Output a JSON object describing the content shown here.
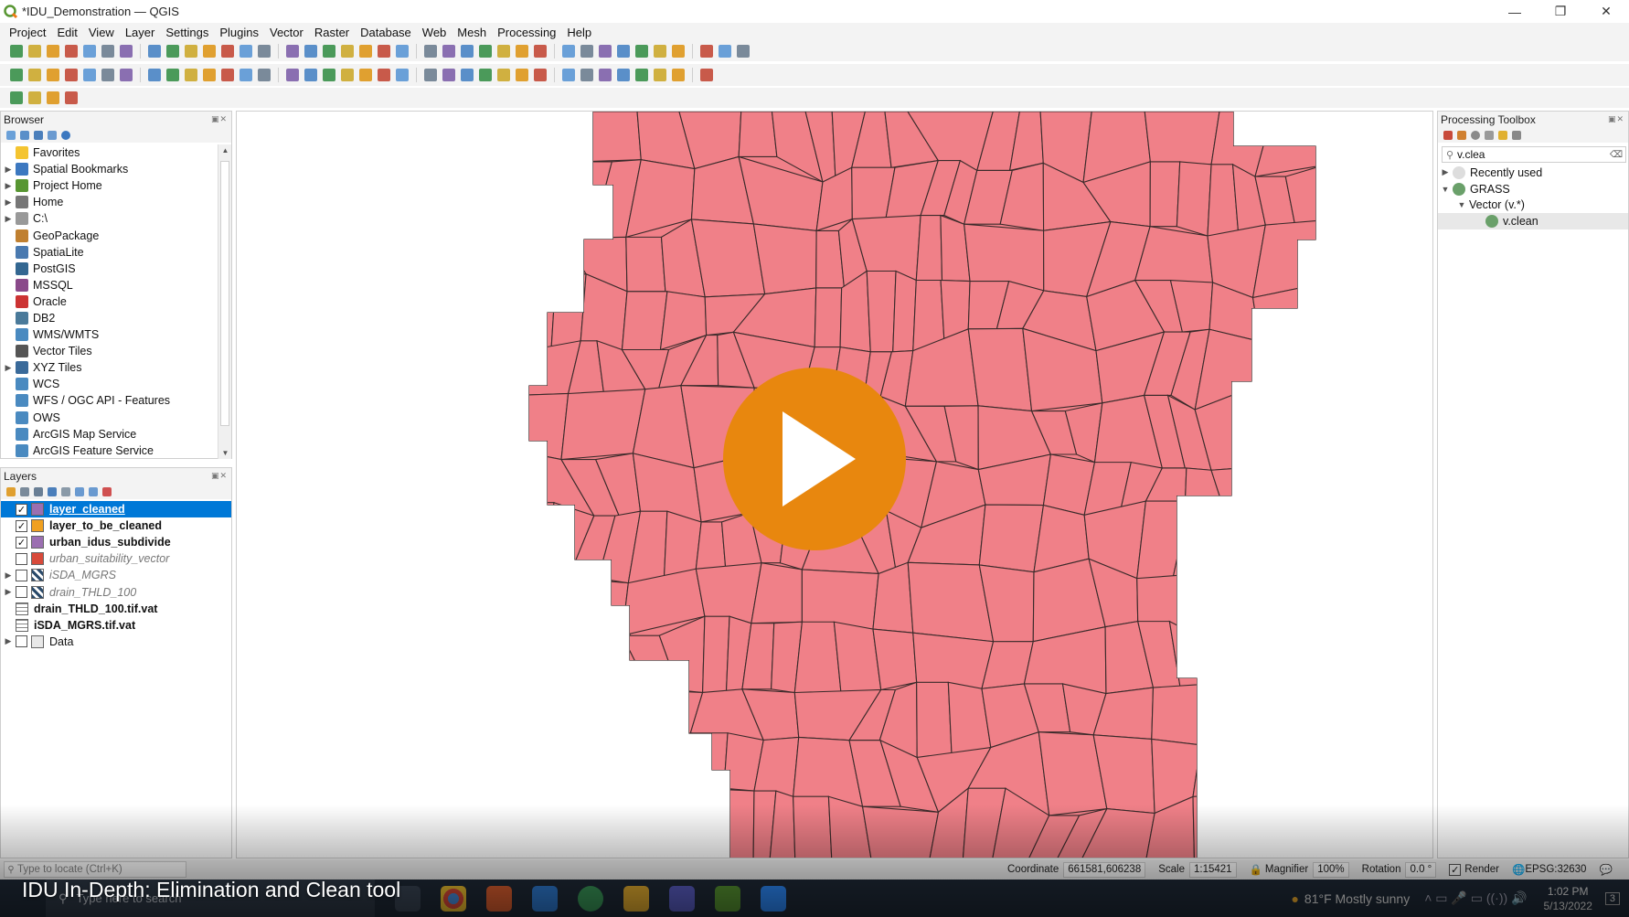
{
  "window": {
    "title": "*IDU_Demonstration — QGIS",
    "controls": [
      "—",
      "❐",
      "✕"
    ]
  },
  "menubar": [
    "Project",
    "Edit",
    "View",
    "Layer",
    "Settings",
    "Plugins",
    "Vector",
    "Raster",
    "Database",
    "Web",
    "Mesh",
    "Processing",
    "Help"
  ],
  "browser": {
    "title": "Browser",
    "items": [
      {
        "label": "Favorites",
        "icon": "star-icon",
        "expandable": false
      },
      {
        "label": "Spatial Bookmarks",
        "icon": "bookmark-icon",
        "expandable": true
      },
      {
        "label": "Project Home",
        "icon": "project-home-icon",
        "expandable": true
      },
      {
        "label": "Home",
        "icon": "home-icon",
        "expandable": true
      },
      {
        "label": "C:\\",
        "icon": "drive-icon",
        "expandable": true
      },
      {
        "label": "GeoPackage",
        "icon": "geopackage-icon",
        "expandable": false
      },
      {
        "label": "SpatiaLite",
        "icon": "spatialite-icon",
        "expandable": false
      },
      {
        "label": "PostGIS",
        "icon": "postgis-icon",
        "expandable": false
      },
      {
        "label": "MSSQL",
        "icon": "mssql-icon",
        "expandable": false
      },
      {
        "label": "Oracle",
        "icon": "oracle-icon",
        "expandable": false
      },
      {
        "label": "DB2",
        "icon": "db2-icon",
        "expandable": false
      },
      {
        "label": "WMS/WMTS",
        "icon": "wms-icon",
        "expandable": false
      },
      {
        "label": "Vector Tiles",
        "icon": "vector-tiles-icon",
        "expandable": false
      },
      {
        "label": "XYZ Tiles",
        "icon": "xyz-tiles-icon",
        "expandable": true
      },
      {
        "label": "WCS",
        "icon": "wcs-icon",
        "expandable": false
      },
      {
        "label": "WFS / OGC API - Features",
        "icon": "wfs-icon",
        "expandable": false
      },
      {
        "label": "OWS",
        "icon": "ows-icon",
        "expandable": false
      },
      {
        "label": "ArcGIS Map Service",
        "icon": "arcgis-map-icon",
        "expandable": false
      },
      {
        "label": "ArcGIS Feature Service",
        "icon": "arcgis-feature-icon",
        "expandable": false
      }
    ]
  },
  "layers": {
    "title": "Layers",
    "items": [
      {
        "name": "layer_cleaned",
        "checked": true,
        "kind": "swatch",
        "color": "#9b6fb1",
        "style": "selected"
      },
      {
        "name": "layer_to_be_cleaned",
        "checked": true,
        "kind": "swatch",
        "color": "#f0a020",
        "style": "bold"
      },
      {
        "name": "urban_idus_subdivide",
        "checked": true,
        "kind": "swatch",
        "color": "#9b6fb1",
        "style": "bold"
      },
      {
        "name": "urban_suitability_vector",
        "checked": false,
        "kind": "swatch",
        "color": "#d84a3a",
        "style": "italic"
      },
      {
        "name": "iSDA_MGRS",
        "checked": false,
        "kind": "raster",
        "style": "italic",
        "expandable": true
      },
      {
        "name": "drain_THLD_100",
        "checked": false,
        "kind": "raster",
        "style": "italic",
        "expandable": true
      },
      {
        "name": "drain_THLD_100.tif.vat",
        "checked": null,
        "kind": "table",
        "style": "bold"
      },
      {
        "name": "iSDA_MGRS.tif.vat",
        "checked": null,
        "kind": "table",
        "style": "bold"
      },
      {
        "name": "Data",
        "checked": false,
        "kind": "group",
        "style": "normal",
        "expandable": true
      }
    ]
  },
  "toolbox": {
    "title": "Processing Toolbox",
    "search_value": "v.clea",
    "tree": [
      {
        "label": "Recently used",
        "level": 0,
        "arrow": "▶",
        "icon": "clock-icon"
      },
      {
        "label": "GRASS",
        "level": 0,
        "arrow": "▼",
        "icon": "grass-icon"
      },
      {
        "label": "Vector (v.*)",
        "level": 1,
        "arrow": "▼",
        "icon": ""
      },
      {
        "label": "v.clean",
        "level": 2,
        "arrow": "",
        "icon": "grass-tool-icon"
      }
    ]
  },
  "statusbar": {
    "locator_placeholder": "Type to locate (Ctrl+K)",
    "coordinate_label": "Coordinate",
    "coordinate_value": "661581,606238",
    "scale_label": "Scale",
    "scale_value": "1:15421",
    "magnifier_label": "Magnifier",
    "magnifier_value": "100%",
    "rotation_label": "Rotation",
    "rotation_value": "0.0 °",
    "render_label": "Render",
    "crs": "EPSG:32630"
  },
  "taskbar": {
    "search_placeholder": "Type here to search",
    "weather": "81°F  Mostly sunny",
    "time": "1:02 PM",
    "date": "5/13/2022",
    "notification_count": "3"
  },
  "video": {
    "title": "IDU In-Depth: Elimination and Clean tool",
    "accent": "#e8870e"
  },
  "map": {
    "fill": "#f08088",
    "stroke": "#3a2a2a"
  }
}
